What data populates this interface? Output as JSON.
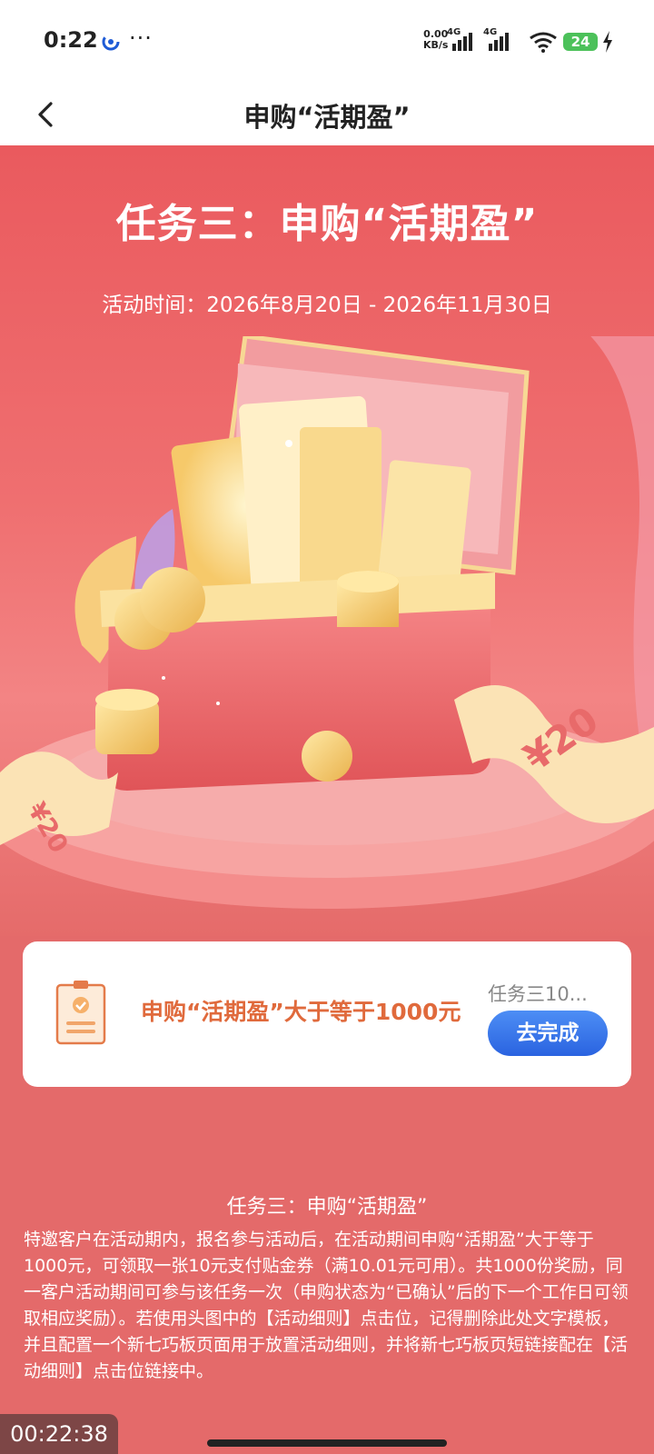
{
  "status": {
    "time": "0:22",
    "more": "···",
    "speed_value": "0.00",
    "speed_unit": "KB/s",
    "network1": "4G",
    "network2": "4G",
    "battery": "24",
    "icons": [
      "app-notification-icon",
      "signal-icon",
      "wifi-icon",
      "charging-icon"
    ]
  },
  "nav": {
    "title": "申购“活期盈”",
    "back_icon": "chevron-left-icon"
  },
  "hero": {
    "title": "任务三：申购“活期盈”",
    "subtitle": "活动时间：2026年8月20日 - 2026年11月30日",
    "coupon_left": "¥20",
    "coupon_right": "¥20"
  },
  "task": {
    "icon": "clipboard-icon",
    "text": "申购“活期盈”大于等于1000元",
    "tag": "任务三10...",
    "button": "去完成"
  },
  "rules": {
    "title": "任务三：申购“活期盈”",
    "body": "特邀客户在活动期内，报名参与活动后，在活动期间申购“活期盈”大于等于1000元，可领取一张10元支付贴金券（满10.01元可用）。共1000份奖励，同一客户活动期间可参与该任务一次（申购状态为“已确认”后的下一个工作日可领取相应奖励）。若使用头图中的【活动细则】点击位，记得删除此处文字模板，并且配置一个新七巧板页面用于放置活动细则，并将新七巧板页短链接配在【活动细则】点击位链接中。"
  },
  "timer": "00:22:38",
  "colors": {
    "background": "#e46a6a",
    "accent_button": "#2a63e0",
    "task_text": "#e06a3c"
  }
}
